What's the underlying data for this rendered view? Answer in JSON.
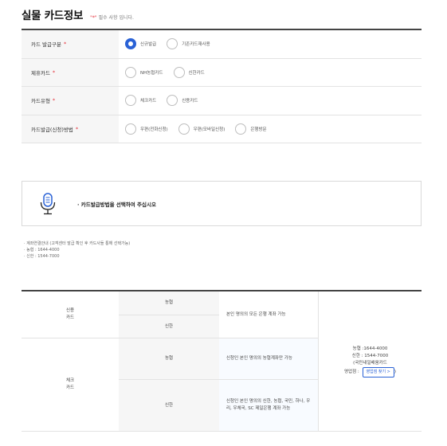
{
  "header": {
    "title": "실물 카드정보",
    "required_star": "\"*\"",
    "required_text": "필수 사항 입니다."
  },
  "form": {
    "rows": [
      {
        "label": "카드 발급구분",
        "star": "*",
        "options": [
          "신규발급",
          "기존카드재사용"
        ],
        "selected": 0
      },
      {
        "label": "제휴카드",
        "star": "*",
        "options": [
          "NH농협카드",
          "신한카드"
        ],
        "selected": -1
      },
      {
        "label": "카드유형",
        "star": "*",
        "options": [
          "체크카드",
          "신용카드"
        ],
        "selected": -1
      },
      {
        "label": "카드발급(신청)방법",
        "star": "*",
        "options": [
          "우편(전화신청)",
          "우편(모바일신청)",
          "은행방문"
        ],
        "selected": -1
      }
    ]
  },
  "notice": {
    "icon": "microphone-icon",
    "text": "· 카드발급방법을 선택하여 주십시오"
  },
  "info_lines": [
    "· 계좌연결안내 (고객센터 발급 확인 후 카드사들 통해 선택가능)",
    "· 농협 : 1644-4000",
    "· 신한 : 1544-7000"
  ],
  "card_table": {
    "credit_label": "신용\n카드",
    "check_label": "체크\n카드",
    "nh": "농협",
    "shinhan": "신한",
    "credit_desc": "본인 명의의 모든 은행 계좌 가능",
    "check_nh_desc": "신청인 본인 명의의 농협계좌만 가능",
    "check_shinhan_desc": "신청인 본인 명의의 신한, 농협, 국민, 하나, 우리, 우체국, SC 제일은행 계좌 가능",
    "contact_nh": "농협 :1644-4000",
    "contact_shinhan": "신한 : 1544-7000",
    "contact_note": "(국민내일배움카드",
    "contact_branch": "영업점 :",
    "find_branch_button": "영업점 찾기 >",
    "contact_close": ")"
  },
  "colors": {
    "accent": "#2a62d6",
    "required": "#e5303a"
  }
}
